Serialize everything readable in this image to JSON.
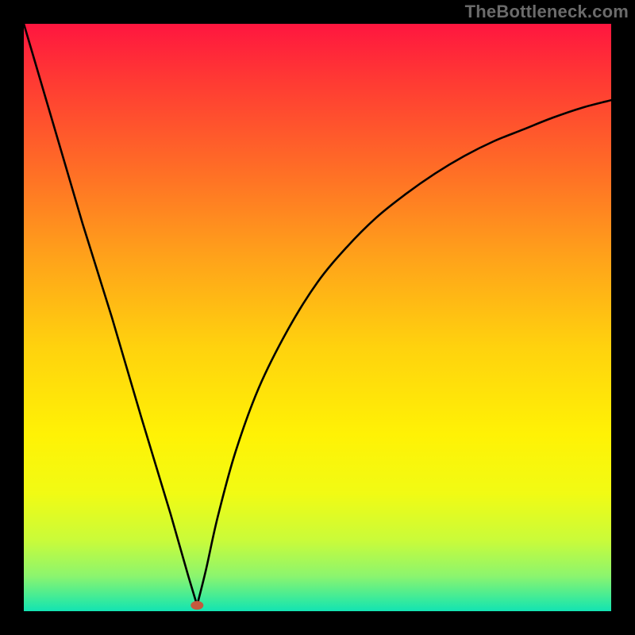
{
  "watermark": "TheBottleneck.com",
  "chart_data": {
    "type": "line",
    "title": "",
    "xlabel": "",
    "ylabel": "",
    "xlim": [
      0,
      100
    ],
    "ylim": [
      0,
      100
    ],
    "grid": false,
    "legend": false,
    "annotations": [],
    "background_gradient_stops": [
      {
        "pos": 0.0,
        "color": "#ff163f"
      },
      {
        "pos": 0.1,
        "color": "#ff3b33"
      },
      {
        "pos": 0.25,
        "color": "#ff6e26"
      },
      {
        "pos": 0.4,
        "color": "#ffa31a"
      },
      {
        "pos": 0.55,
        "color": "#ffd20e"
      },
      {
        "pos": 0.7,
        "color": "#fff205"
      },
      {
        "pos": 0.8,
        "color": "#f1fb14"
      },
      {
        "pos": 0.88,
        "color": "#c9fb3a"
      },
      {
        "pos": 0.94,
        "color": "#8cf56e"
      },
      {
        "pos": 0.985,
        "color": "#2fe9a1"
      },
      {
        "pos": 1.0,
        "color": "#13e3b3"
      }
    ],
    "marker": {
      "x": 29.5,
      "y": 1.0,
      "color": "#c4593e"
    },
    "series": [
      {
        "name": "left-branch",
        "x": [
          0,
          5,
          10,
          15,
          20,
          25,
          28,
          29.5
        ],
        "y": [
          100,
          83,
          66,
          50,
          33,
          16.5,
          6,
          1
        ]
      },
      {
        "name": "right-branch",
        "x": [
          29.5,
          31,
          33,
          36,
          40,
          45,
          50,
          55,
          60,
          65,
          70,
          75,
          80,
          85,
          90,
          95,
          100
        ],
        "y": [
          1,
          7,
          16,
          27,
          38,
          48,
          56,
          62,
          67,
          71,
          74.5,
          77.5,
          80,
          82,
          84,
          85.7,
          87
        ]
      }
    ]
  }
}
